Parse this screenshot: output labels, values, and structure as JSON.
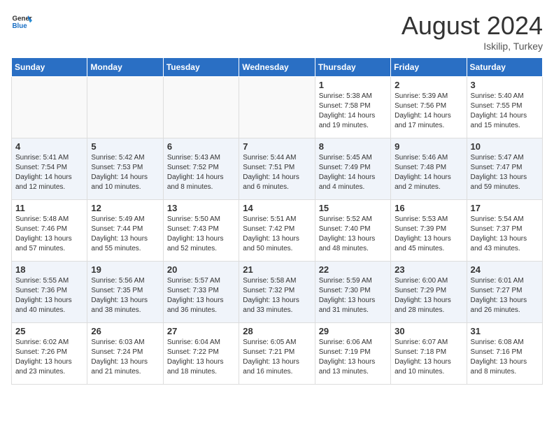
{
  "header": {
    "logo_general": "General",
    "logo_blue": "Blue",
    "month_title": "August 2024",
    "location": "Iskilip, Turkey"
  },
  "days_of_week": [
    "Sunday",
    "Monday",
    "Tuesday",
    "Wednesday",
    "Thursday",
    "Friday",
    "Saturday"
  ],
  "weeks": [
    [
      {
        "day": "",
        "info": ""
      },
      {
        "day": "",
        "info": ""
      },
      {
        "day": "",
        "info": ""
      },
      {
        "day": "",
        "info": ""
      },
      {
        "day": "1",
        "info": "Sunrise: 5:38 AM\nSunset: 7:58 PM\nDaylight: 14 hours\nand 19 minutes."
      },
      {
        "day": "2",
        "info": "Sunrise: 5:39 AM\nSunset: 7:56 PM\nDaylight: 14 hours\nand 17 minutes."
      },
      {
        "day": "3",
        "info": "Sunrise: 5:40 AM\nSunset: 7:55 PM\nDaylight: 14 hours\nand 15 minutes."
      }
    ],
    [
      {
        "day": "4",
        "info": "Sunrise: 5:41 AM\nSunset: 7:54 PM\nDaylight: 14 hours\nand 12 minutes."
      },
      {
        "day": "5",
        "info": "Sunrise: 5:42 AM\nSunset: 7:53 PM\nDaylight: 14 hours\nand 10 minutes."
      },
      {
        "day": "6",
        "info": "Sunrise: 5:43 AM\nSunset: 7:52 PM\nDaylight: 14 hours\nand 8 minutes."
      },
      {
        "day": "7",
        "info": "Sunrise: 5:44 AM\nSunset: 7:51 PM\nDaylight: 14 hours\nand 6 minutes."
      },
      {
        "day": "8",
        "info": "Sunrise: 5:45 AM\nSunset: 7:49 PM\nDaylight: 14 hours\nand 4 minutes."
      },
      {
        "day": "9",
        "info": "Sunrise: 5:46 AM\nSunset: 7:48 PM\nDaylight: 14 hours\nand 2 minutes."
      },
      {
        "day": "10",
        "info": "Sunrise: 5:47 AM\nSunset: 7:47 PM\nDaylight: 13 hours\nand 59 minutes."
      }
    ],
    [
      {
        "day": "11",
        "info": "Sunrise: 5:48 AM\nSunset: 7:46 PM\nDaylight: 13 hours\nand 57 minutes."
      },
      {
        "day": "12",
        "info": "Sunrise: 5:49 AM\nSunset: 7:44 PM\nDaylight: 13 hours\nand 55 minutes."
      },
      {
        "day": "13",
        "info": "Sunrise: 5:50 AM\nSunset: 7:43 PM\nDaylight: 13 hours\nand 52 minutes."
      },
      {
        "day": "14",
        "info": "Sunrise: 5:51 AM\nSunset: 7:42 PM\nDaylight: 13 hours\nand 50 minutes."
      },
      {
        "day": "15",
        "info": "Sunrise: 5:52 AM\nSunset: 7:40 PM\nDaylight: 13 hours\nand 48 minutes."
      },
      {
        "day": "16",
        "info": "Sunrise: 5:53 AM\nSunset: 7:39 PM\nDaylight: 13 hours\nand 45 minutes."
      },
      {
        "day": "17",
        "info": "Sunrise: 5:54 AM\nSunset: 7:37 PM\nDaylight: 13 hours\nand 43 minutes."
      }
    ],
    [
      {
        "day": "18",
        "info": "Sunrise: 5:55 AM\nSunset: 7:36 PM\nDaylight: 13 hours\nand 40 minutes."
      },
      {
        "day": "19",
        "info": "Sunrise: 5:56 AM\nSunset: 7:35 PM\nDaylight: 13 hours\nand 38 minutes."
      },
      {
        "day": "20",
        "info": "Sunrise: 5:57 AM\nSunset: 7:33 PM\nDaylight: 13 hours\nand 36 minutes."
      },
      {
        "day": "21",
        "info": "Sunrise: 5:58 AM\nSunset: 7:32 PM\nDaylight: 13 hours\nand 33 minutes."
      },
      {
        "day": "22",
        "info": "Sunrise: 5:59 AM\nSunset: 7:30 PM\nDaylight: 13 hours\nand 31 minutes."
      },
      {
        "day": "23",
        "info": "Sunrise: 6:00 AM\nSunset: 7:29 PM\nDaylight: 13 hours\nand 28 minutes."
      },
      {
        "day": "24",
        "info": "Sunrise: 6:01 AM\nSunset: 7:27 PM\nDaylight: 13 hours\nand 26 minutes."
      }
    ],
    [
      {
        "day": "25",
        "info": "Sunrise: 6:02 AM\nSunset: 7:26 PM\nDaylight: 13 hours\nand 23 minutes."
      },
      {
        "day": "26",
        "info": "Sunrise: 6:03 AM\nSunset: 7:24 PM\nDaylight: 13 hours\nand 21 minutes."
      },
      {
        "day": "27",
        "info": "Sunrise: 6:04 AM\nSunset: 7:22 PM\nDaylight: 13 hours\nand 18 minutes."
      },
      {
        "day": "28",
        "info": "Sunrise: 6:05 AM\nSunset: 7:21 PM\nDaylight: 13 hours\nand 16 minutes."
      },
      {
        "day": "29",
        "info": "Sunrise: 6:06 AM\nSunset: 7:19 PM\nDaylight: 13 hours\nand 13 minutes."
      },
      {
        "day": "30",
        "info": "Sunrise: 6:07 AM\nSunset: 7:18 PM\nDaylight: 13 hours\nand 10 minutes."
      },
      {
        "day": "31",
        "info": "Sunrise: 6:08 AM\nSunset: 7:16 PM\nDaylight: 13 hours\nand 8 minutes."
      }
    ]
  ]
}
